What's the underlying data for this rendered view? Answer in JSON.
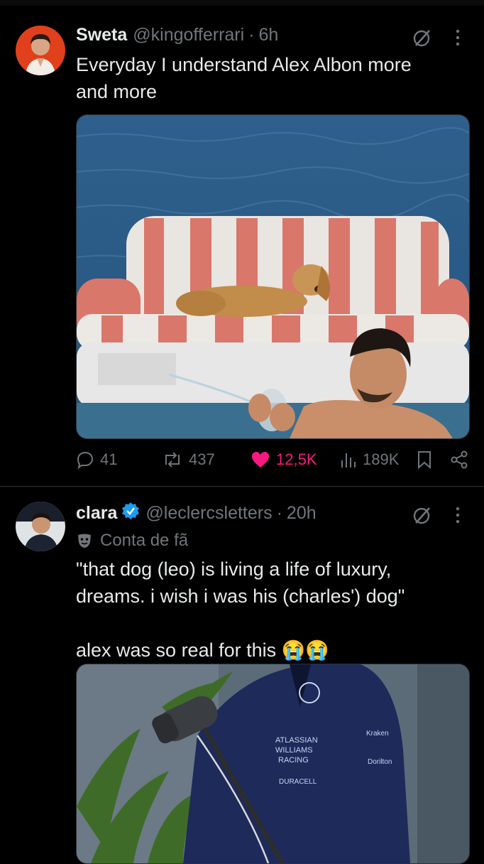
{
  "tweets": [
    {
      "name": "Sweta",
      "handle": "@kingofferrari",
      "time": "6h",
      "text": "Everyday I understand Alex Albon more\nand more",
      "stats": {
        "replies": "41",
        "reposts": "437",
        "likes": "12,5K",
        "views": "189K"
      },
      "like_color": "#f91880"
    },
    {
      "name": "clara",
      "handle": "@leclercsletters",
      "time": "20h",
      "fan_label": "Conta de fã",
      "text": "\"that dog (leo) is living a life of luxury,\ndreams. i wish i was his (charles') dog\"\n\nalex was so real for this 😭😭",
      "verified_color": "#1d9bf0"
    }
  ],
  "icons": {
    "reply": "reply-icon",
    "repost": "repost-icon",
    "like": "heart-icon",
    "views": "views-icon",
    "bookmark": "bookmark-icon",
    "share": "share-icon",
    "grok": "grok-icon",
    "more": "more-icon"
  }
}
